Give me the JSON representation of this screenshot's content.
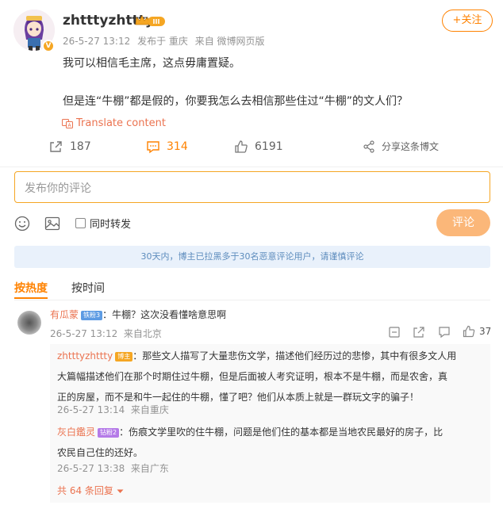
{
  "post": {
    "username": "zhtttyzhttty",
    "crown_badge": "III",
    "verified_badge": "V",
    "meta": {
      "time": "26-5-27 13:12",
      "published_at": "发布于 重庆",
      "source": "来自 微博网页版"
    },
    "follow_label": "+关注",
    "paragraphs": [
      "我可以相信毛主席，这点毋庸置疑。",
      "但是连“牛棚”都是假的，你要我怎么去相信那些住过“牛棚”的文人们？"
    ],
    "translate_label": "Translate content",
    "actions": {
      "repost_count": "187",
      "comment_count": "314",
      "like_count": "6191",
      "share_label": "分享这条博文"
    }
  },
  "composer": {
    "placeholder": "发布你的评论",
    "repost_label": "同时转发",
    "submit_label": "评论"
  },
  "notice": "30天内，博主已拉黑多于30名恶意评论用户，请谨慎评论",
  "sort": {
    "hot": "按热度",
    "time": "按时间"
  },
  "comments": [
    {
      "name": "有瓜蒙",
      "tag": "铁粉3",
      "text": "：牛棚？这次没看懂啥意思啊",
      "time": "26-5-27 13:12",
      "location": "来自北京",
      "like_count": "37",
      "replies": [
        {
          "name": "zhtttyzhttty",
          "tag": "博主",
          "lines": [
            "：那些文人描写了大量悲伤文学，描述他们经历过的悲惨，其中有很多文人用",
            "大篇幅描述他们在那个时期住过牛棚，但是后面被人考究证明，根本不是牛棚，而是农舍，真",
            "正的房屋，而不是和牛一起住的牛棚，懂了吧？他们从本质上就是一群玩文字的骗子！"
          ],
          "time": "26-5-27 13:14",
          "location": "来自重庆"
        },
        {
          "name": "灰白鑑灵",
          "tag": "钻粉2",
          "lines": [
            "：伤痕文学里吹的住牛棚，问题是他们住的基本都是当地农民最好的房子，比",
            "农民自己住的还好。"
          ],
          "time": "26-5-27 13:38",
          "location": "来自广东"
        }
      ],
      "more_replies": "共 64 条回复"
    }
  ],
  "colors": {
    "accent": "#ff8200",
    "link": "#eb7350",
    "notice_bg": "#e9f1fb",
    "notice_text": "#5d8cbd",
    "submit_disabled": "#fbb779"
  }
}
